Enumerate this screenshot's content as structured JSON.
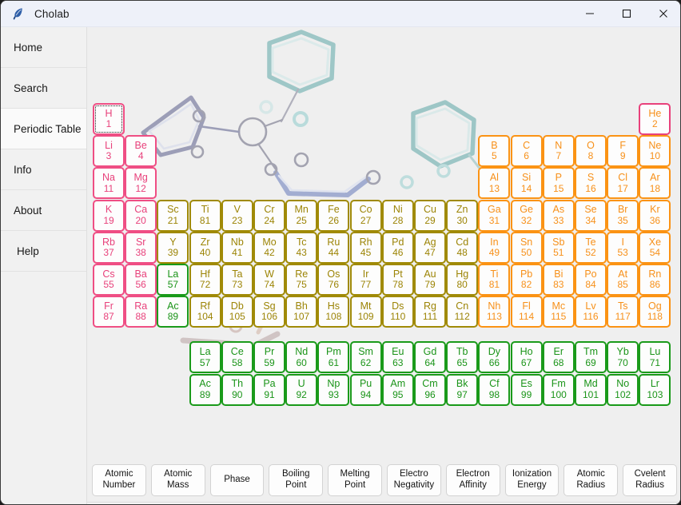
{
  "window": {
    "title": "Cholab",
    "icon": "feather-quill-icon",
    "controls": {
      "minimize": "minimize-icon",
      "maximize": "maximize-icon",
      "close": "close-icon"
    }
  },
  "sidebar": {
    "items": [
      {
        "label": "Home",
        "selected": false
      },
      {
        "label": "Search",
        "selected": false
      },
      {
        "label": "Periodic Table",
        "selected": true
      },
      {
        "label": "Info",
        "selected": false
      },
      {
        "label": "About",
        "selected": false
      },
      {
        "label": "Help",
        "selected": false
      }
    ]
  },
  "colors": {
    "alkali": "#e8417b",
    "transition": "#9c8405",
    "post_transition": "#f79019",
    "f_block": "#1a9418",
    "cell_background": "#fdfdfd",
    "content_background": "#efefef",
    "sidebar_background": "#f1f1f1",
    "titlebar_background": "#eef1f9"
  },
  "periodic_table": {
    "focused_cell": "H",
    "main": [
      {
        "sym": "H",
        "num": "1",
        "col": 1,
        "row": 1,
        "group": "alkali",
        "focus": true
      },
      {
        "sym": "He",
        "num": "2",
        "col": 18,
        "row": 1,
        "group": "noble-he"
      },
      {
        "sym": "Li",
        "num": "3",
        "col": 1,
        "row": 2,
        "group": "alkali"
      },
      {
        "sym": "Be",
        "num": "4",
        "col": 2,
        "row": 2,
        "group": "alkali"
      },
      {
        "sym": "B",
        "num": "5",
        "col": 13,
        "row": 2,
        "group": "post"
      },
      {
        "sym": "C",
        "num": "6",
        "col": 14,
        "row": 2,
        "group": "post"
      },
      {
        "sym": "N",
        "num": "7",
        "col": 15,
        "row": 2,
        "group": "post"
      },
      {
        "sym": "O",
        "num": "8",
        "col": 16,
        "row": 2,
        "group": "post"
      },
      {
        "sym": "F",
        "num": "9",
        "col": 17,
        "row": 2,
        "group": "post"
      },
      {
        "sym": "Ne",
        "num": "10",
        "col": 18,
        "row": 2,
        "group": "post"
      },
      {
        "sym": "Na",
        "num": "11",
        "col": 1,
        "row": 3,
        "group": "alkali"
      },
      {
        "sym": "Mg",
        "num": "12",
        "col": 2,
        "row": 3,
        "group": "alkali"
      },
      {
        "sym": "Al",
        "num": "13",
        "col": 13,
        "row": 3,
        "group": "post"
      },
      {
        "sym": "Si",
        "num": "14",
        "col": 14,
        "row": 3,
        "group": "post"
      },
      {
        "sym": "P",
        "num": "15",
        "col": 15,
        "row": 3,
        "group": "post"
      },
      {
        "sym": "S",
        "num": "16",
        "col": 16,
        "row": 3,
        "group": "post"
      },
      {
        "sym": "Cl",
        "num": "17",
        "col": 17,
        "row": 3,
        "group": "post"
      },
      {
        "sym": "Ar",
        "num": "18",
        "col": 18,
        "row": 3,
        "group": "post"
      },
      {
        "sym": "K",
        "num": "19",
        "col": 1,
        "row": 4,
        "group": "alkali"
      },
      {
        "sym": "Ca",
        "num": "20",
        "col": 2,
        "row": 4,
        "group": "alkali"
      },
      {
        "sym": "Sc",
        "num": "21",
        "col": 3,
        "row": 4,
        "group": "trans"
      },
      {
        "sym": "Ti",
        "num": "81",
        "col": 4,
        "row": 4,
        "group": "trans"
      },
      {
        "sym": "V",
        "num": "23",
        "col": 5,
        "row": 4,
        "group": "trans"
      },
      {
        "sym": "Cr",
        "num": "24",
        "col": 6,
        "row": 4,
        "group": "trans"
      },
      {
        "sym": "Mn",
        "num": "25",
        "col": 7,
        "row": 4,
        "group": "trans"
      },
      {
        "sym": "Fe",
        "num": "26",
        "col": 8,
        "row": 4,
        "group": "trans"
      },
      {
        "sym": "Co",
        "num": "27",
        "col": 9,
        "row": 4,
        "group": "trans"
      },
      {
        "sym": "Ni",
        "num": "28",
        "col": 10,
        "row": 4,
        "group": "trans"
      },
      {
        "sym": "Cu",
        "num": "29",
        "col": 11,
        "row": 4,
        "group": "trans"
      },
      {
        "sym": "Zn",
        "num": "30",
        "col": 12,
        "row": 4,
        "group": "trans"
      },
      {
        "sym": "Ga",
        "num": "31",
        "col": 13,
        "row": 4,
        "group": "post"
      },
      {
        "sym": "Ge",
        "num": "32",
        "col": 14,
        "row": 4,
        "group": "post"
      },
      {
        "sym": "As",
        "num": "33",
        "col": 15,
        "row": 4,
        "group": "post"
      },
      {
        "sym": "Se",
        "num": "34",
        "col": 16,
        "row": 4,
        "group": "post"
      },
      {
        "sym": "Br",
        "num": "35",
        "col": 17,
        "row": 4,
        "group": "post"
      },
      {
        "sym": "Kr",
        "num": "36",
        "col": 18,
        "row": 4,
        "group": "post"
      },
      {
        "sym": "Rb",
        "num": "37",
        "col": 1,
        "row": 5,
        "group": "alkali"
      },
      {
        "sym": "Sr",
        "num": "38",
        "col": 2,
        "row": 5,
        "group": "alkali"
      },
      {
        "sym": "Y",
        "num": "39",
        "col": 3,
        "row": 5,
        "group": "trans"
      },
      {
        "sym": "Zr",
        "num": "40",
        "col": 4,
        "row": 5,
        "group": "trans"
      },
      {
        "sym": "Nb",
        "num": "41",
        "col": 5,
        "row": 5,
        "group": "trans"
      },
      {
        "sym": "Mo",
        "num": "42",
        "col": 6,
        "row": 5,
        "group": "trans"
      },
      {
        "sym": "Tc",
        "num": "43",
        "col": 7,
        "row": 5,
        "group": "trans"
      },
      {
        "sym": "Ru",
        "num": "44",
        "col": 8,
        "row": 5,
        "group": "trans"
      },
      {
        "sym": "Rh",
        "num": "45",
        "col": 9,
        "row": 5,
        "group": "trans"
      },
      {
        "sym": "Pd",
        "num": "46",
        "col": 10,
        "row": 5,
        "group": "trans"
      },
      {
        "sym": "Ag",
        "num": "47",
        "col": 11,
        "row": 5,
        "group": "trans"
      },
      {
        "sym": "Cd",
        "num": "48",
        "col": 12,
        "row": 5,
        "group": "trans"
      },
      {
        "sym": "In",
        "num": "49",
        "col": 13,
        "row": 5,
        "group": "post"
      },
      {
        "sym": "Sn",
        "num": "50",
        "col": 14,
        "row": 5,
        "group": "post"
      },
      {
        "sym": "Sb",
        "num": "51",
        "col": 15,
        "row": 5,
        "group": "post"
      },
      {
        "sym": "Te",
        "num": "52",
        "col": 16,
        "row": 5,
        "group": "post"
      },
      {
        "sym": "I",
        "num": "53",
        "col": 17,
        "row": 5,
        "group": "post"
      },
      {
        "sym": "Xe",
        "num": "54",
        "col": 18,
        "row": 5,
        "group": "post"
      },
      {
        "sym": "Cs",
        "num": "55",
        "col": 1,
        "row": 6,
        "group": "alkali"
      },
      {
        "sym": "Ba",
        "num": "56",
        "col": 2,
        "row": 6,
        "group": "alkali"
      },
      {
        "sym": "La",
        "num": "57",
        "col": 3,
        "row": 6,
        "group": "fblock"
      },
      {
        "sym": "Hf",
        "num": "72",
        "col": 4,
        "row": 6,
        "group": "trans"
      },
      {
        "sym": "Ta",
        "num": "73",
        "col": 5,
        "row": 6,
        "group": "trans"
      },
      {
        "sym": "W",
        "num": "74",
        "col": 6,
        "row": 6,
        "group": "trans"
      },
      {
        "sym": "Re",
        "num": "75",
        "col": 7,
        "row": 6,
        "group": "trans"
      },
      {
        "sym": "Os",
        "num": "76",
        "col": 8,
        "row": 6,
        "group": "trans"
      },
      {
        "sym": "Ir",
        "num": "77",
        "col": 9,
        "row": 6,
        "group": "trans"
      },
      {
        "sym": "Pt",
        "num": "78",
        "col": 10,
        "row": 6,
        "group": "trans"
      },
      {
        "sym": "Au",
        "num": "79",
        "col": 11,
        "row": 6,
        "group": "trans"
      },
      {
        "sym": "Hg",
        "num": "80",
        "col": 12,
        "row": 6,
        "group": "trans"
      },
      {
        "sym": "Ti",
        "num": "81",
        "col": 13,
        "row": 6,
        "group": "post"
      },
      {
        "sym": "Pb",
        "num": "82",
        "col": 14,
        "row": 6,
        "group": "post"
      },
      {
        "sym": "Bi",
        "num": "83",
        "col": 15,
        "row": 6,
        "group": "post"
      },
      {
        "sym": "Po",
        "num": "84",
        "col": 16,
        "row": 6,
        "group": "post"
      },
      {
        "sym": "At",
        "num": "85",
        "col": 17,
        "row": 6,
        "group": "post"
      },
      {
        "sym": "Rn",
        "num": "86",
        "col": 18,
        "row": 6,
        "group": "post"
      },
      {
        "sym": "Fr",
        "num": "87",
        "col": 1,
        "row": 7,
        "group": "alkali"
      },
      {
        "sym": "Ra",
        "num": "88",
        "col": 2,
        "row": 7,
        "group": "alkali"
      },
      {
        "sym": "Ac",
        "num": "89",
        "col": 3,
        "row": 7,
        "group": "fblock"
      },
      {
        "sym": "Rf",
        "num": "104",
        "col": 4,
        "row": 7,
        "group": "trans"
      },
      {
        "sym": "Db",
        "num": "105",
        "col": 5,
        "row": 7,
        "group": "trans"
      },
      {
        "sym": "Sg",
        "num": "106",
        "col": 6,
        "row": 7,
        "group": "trans"
      },
      {
        "sym": "Bh",
        "num": "107",
        "col": 7,
        "row": 7,
        "group": "trans"
      },
      {
        "sym": "Hs",
        "num": "108",
        "col": 8,
        "row": 7,
        "group": "trans"
      },
      {
        "sym": "Mt",
        "num": "109",
        "col": 9,
        "row": 7,
        "group": "trans"
      },
      {
        "sym": "Ds",
        "num": "110",
        "col": 10,
        "row": 7,
        "group": "trans"
      },
      {
        "sym": "Rg",
        "num": "111",
        "col": 11,
        "row": 7,
        "group": "trans"
      },
      {
        "sym": "Cn",
        "num": "112",
        "col": 12,
        "row": 7,
        "group": "trans"
      },
      {
        "sym": "Nh",
        "num": "113",
        "col": 13,
        "row": 7,
        "group": "post"
      },
      {
        "sym": "Fl",
        "num": "114",
        "col": 14,
        "row": 7,
        "group": "post"
      },
      {
        "sym": "Mc",
        "num": "115",
        "col": 15,
        "row": 7,
        "group": "post"
      },
      {
        "sym": "Lv",
        "num": "116",
        "col": 16,
        "row": 7,
        "group": "post"
      },
      {
        "sym": "Ts",
        "num": "117",
        "col": 17,
        "row": 7,
        "group": "post"
      },
      {
        "sym": "Og",
        "num": "118",
        "col": 18,
        "row": 7,
        "group": "post"
      }
    ],
    "fblock": [
      {
        "sym": "La",
        "num": "57",
        "col": 1,
        "row": 1,
        "group": "fblock"
      },
      {
        "sym": "Ce",
        "num": "58",
        "col": 2,
        "row": 1,
        "group": "fblock"
      },
      {
        "sym": "Pr",
        "num": "59",
        "col": 3,
        "row": 1,
        "group": "fblock"
      },
      {
        "sym": "Nd",
        "num": "60",
        "col": 4,
        "row": 1,
        "group": "fblock"
      },
      {
        "sym": "Pm",
        "num": "61",
        "col": 5,
        "row": 1,
        "group": "fblock"
      },
      {
        "sym": "Sm",
        "num": "62",
        "col": 6,
        "row": 1,
        "group": "fblock"
      },
      {
        "sym": "Eu",
        "num": "63",
        "col": 7,
        "row": 1,
        "group": "fblock"
      },
      {
        "sym": "Gd",
        "num": "64",
        "col": 8,
        "row": 1,
        "group": "fblock"
      },
      {
        "sym": "Tb",
        "num": "65",
        "col": 9,
        "row": 1,
        "group": "fblock"
      },
      {
        "sym": "Dy",
        "num": "66",
        "col": 10,
        "row": 1,
        "group": "fblock"
      },
      {
        "sym": "Ho",
        "num": "67",
        "col": 11,
        "row": 1,
        "group": "fblock"
      },
      {
        "sym": "Er",
        "num": "68",
        "col": 12,
        "row": 1,
        "group": "fblock"
      },
      {
        "sym": "Tm",
        "num": "69",
        "col": 13,
        "row": 1,
        "group": "fblock"
      },
      {
        "sym": "Yb",
        "num": "70",
        "col": 14,
        "row": 1,
        "group": "fblock"
      },
      {
        "sym": "Lu",
        "num": "71",
        "col": 15,
        "row": 1,
        "group": "fblock"
      },
      {
        "sym": "Ac",
        "num": "89",
        "col": 1,
        "row": 2,
        "group": "fblock"
      },
      {
        "sym": "Th",
        "num": "90",
        "col": 2,
        "row": 2,
        "group": "fblock"
      },
      {
        "sym": "Pa",
        "num": "91",
        "col": 3,
        "row": 2,
        "group": "fblock"
      },
      {
        "sym": "U",
        "num": "92",
        "col": 4,
        "row": 2,
        "group": "fblock"
      },
      {
        "sym": "Np",
        "num": "93",
        "col": 5,
        "row": 2,
        "group": "fblock"
      },
      {
        "sym": "Pu",
        "num": "94",
        "col": 6,
        "row": 2,
        "group": "fblock"
      },
      {
        "sym": "Am",
        "num": "95",
        "col": 7,
        "row": 2,
        "group": "fblock"
      },
      {
        "sym": "Cm",
        "num": "96",
        "col": 8,
        "row": 2,
        "group": "fblock"
      },
      {
        "sym": "Bk",
        "num": "97",
        "col": 9,
        "row": 2,
        "group": "fblock"
      },
      {
        "sym": "Cf",
        "num": "98",
        "col": 10,
        "row": 2,
        "group": "fblock"
      },
      {
        "sym": "Es",
        "num": "99",
        "col": 11,
        "row": 2,
        "group": "fblock"
      },
      {
        "sym": "Fm",
        "num": "100",
        "col": 12,
        "row": 2,
        "group": "fblock"
      },
      {
        "sym": "Md",
        "num": "101",
        "col": 13,
        "row": 2,
        "group": "fblock"
      },
      {
        "sym": "No",
        "num": "102",
        "col": 14,
        "row": 2,
        "group": "fblock"
      },
      {
        "sym": "Lr",
        "num": "103",
        "col": 15,
        "row": 2,
        "group": "fblock"
      }
    ]
  },
  "property_buttons": [
    {
      "label": "Atomic\nNumber",
      "name": "atomic-number"
    },
    {
      "label": "Atomic\nMass",
      "name": "atomic-mass"
    },
    {
      "label": "Phase",
      "name": "phase"
    },
    {
      "label": "Boiling\nPoint",
      "name": "boiling-point"
    },
    {
      "label": "Melting\nPoint",
      "name": "melting-point"
    },
    {
      "label": "Electro\nNegativity",
      "name": "electro-negativity"
    },
    {
      "label": "Electron\nAffinity",
      "name": "electron-affinity"
    },
    {
      "label": "Ionization\nEnergy",
      "name": "ionization-energy"
    },
    {
      "label": "Atomic\nRadius",
      "name": "atomic-radius"
    },
    {
      "label": "Cvelent\nRadius",
      "name": "cvelent-radius"
    }
  ]
}
